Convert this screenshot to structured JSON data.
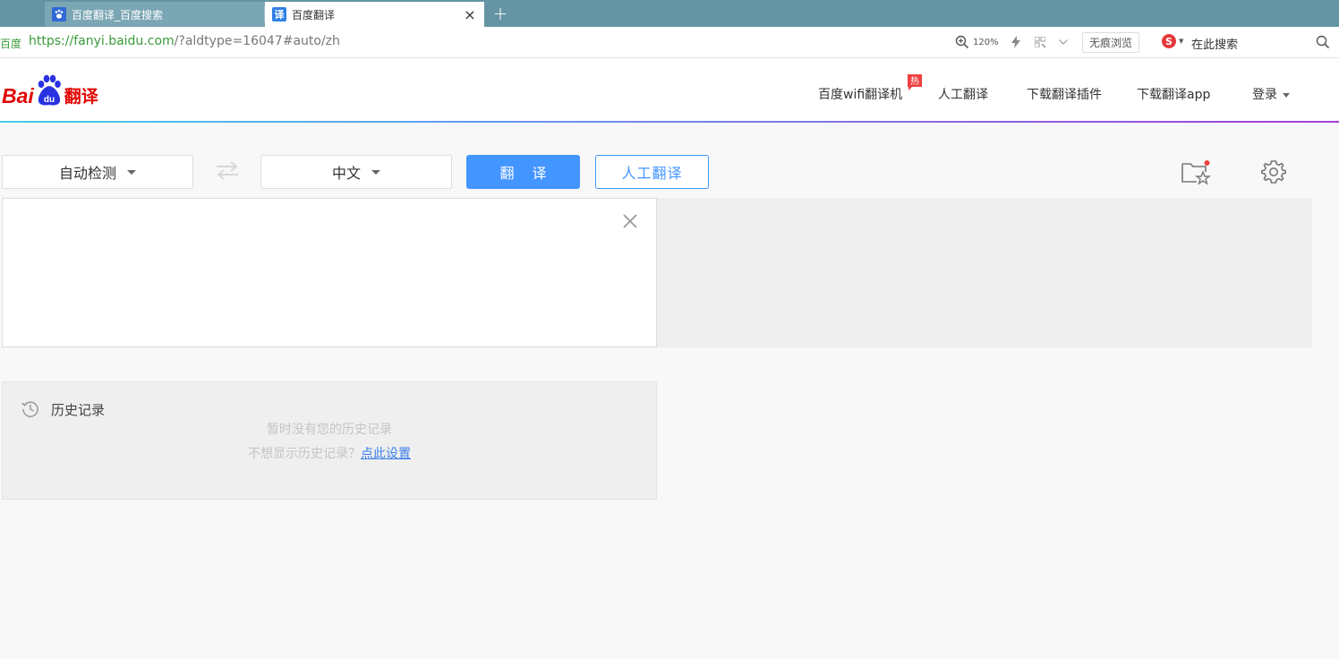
{
  "browser": {
    "tabs": [
      {
        "label": "百度翻译_百度搜索",
        "icon": "baidu-paw-icon",
        "active": false
      },
      {
        "label": "百度翻译",
        "icon": "translate-icon",
        "icon_text": "译",
        "active": true
      }
    ],
    "close_symbol": "×",
    "new_tab_symbol": "+",
    "site_label": "百度",
    "url": {
      "protocol": "https://",
      "host": "fanyi.baidu.com",
      "path": "/?aldtype=16047#auto/zh"
    },
    "zoom": "120%",
    "incognito_label": "无痕浏览",
    "search_engine_letter": "S",
    "search_placeholder": "在此搜索"
  },
  "header": {
    "logo": {
      "bai": "Bai",
      "du": "du",
      "fanyi": "翻译"
    },
    "nav": [
      {
        "label": "百度wifi翻译机"
      },
      {
        "label": "人工翻译"
      },
      {
        "label": "下载翻译插件"
      },
      {
        "label": "下载翻译app"
      }
    ],
    "hot_badge": "热",
    "login_label": "登录"
  },
  "toolbar": {
    "source_lang": "自动检测",
    "target_lang": "中文",
    "translate_label": "翻译",
    "human_translate_label": "人工翻译"
  },
  "history": {
    "title": "历史记录",
    "empty_text": "暂时没有您的历史记录",
    "hint_text": "不想显示历史记录？",
    "hint_link": "点此设置"
  },
  "colors": {
    "tabstrip": "#6594a4",
    "accent_blue": "#4395ff",
    "brand_red": "#e10602",
    "output_bg": "#efefef"
  }
}
